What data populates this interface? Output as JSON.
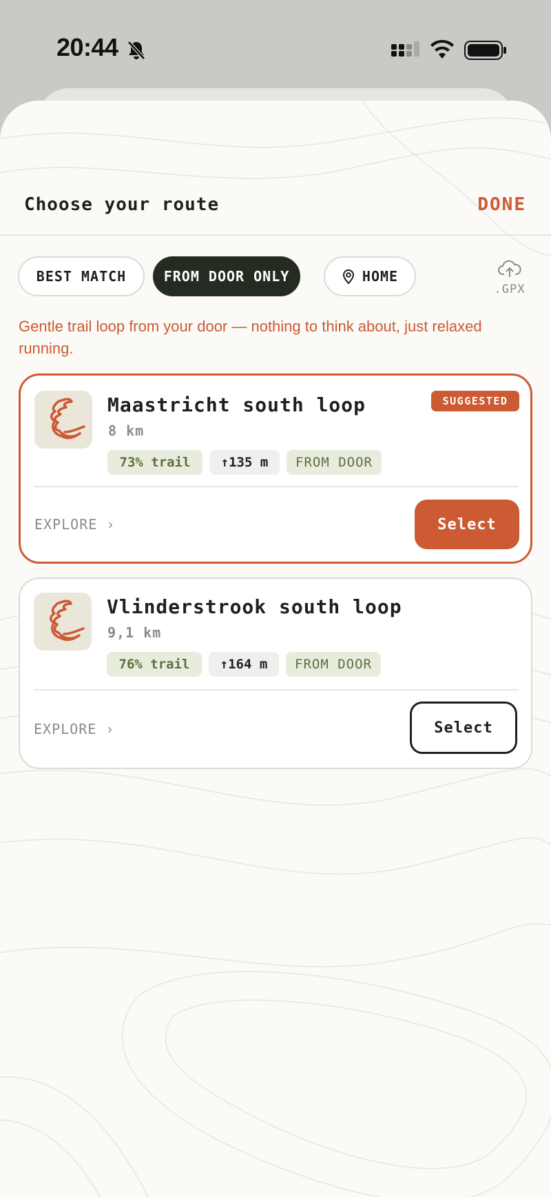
{
  "status_bar": {
    "time": "20:44"
  },
  "header": {
    "title": "Choose your route",
    "done_label": "DONE"
  },
  "filters": [
    {
      "label": "BEST MATCH",
      "active": false
    },
    {
      "label": "FROM DOOR ONLY",
      "active": true
    },
    {
      "label": "HOME",
      "active": false,
      "icon": "location-pin-icon"
    }
  ],
  "gpx": {
    "label": ".GPX",
    "icon": "cloud-upload-icon"
  },
  "description": "Gentle trail loop from your door — nothing to think about, just relaxed running.",
  "routes": [
    {
      "name": "Maastricht south loop",
      "distance": "8 km",
      "trail": "73% trail",
      "elevation": "↑135 m",
      "tag": "FROM DOOR",
      "badge": "SUGGESTED",
      "explore": "EXPLORE ›",
      "select": "Select"
    },
    {
      "name": "Vlinderstrook south loop",
      "distance": "9,1 km",
      "trail": "76% trail",
      "elevation": "↑164 m",
      "tag": "FROM DOOR",
      "explore": "EXPLORE ›",
      "select": "Select"
    }
  ],
  "colors": {
    "accent": "#cc5a33",
    "dark": "#262b22",
    "trail_green": "#5d6e3e",
    "sheet_bg": "#fbfaf6"
  }
}
